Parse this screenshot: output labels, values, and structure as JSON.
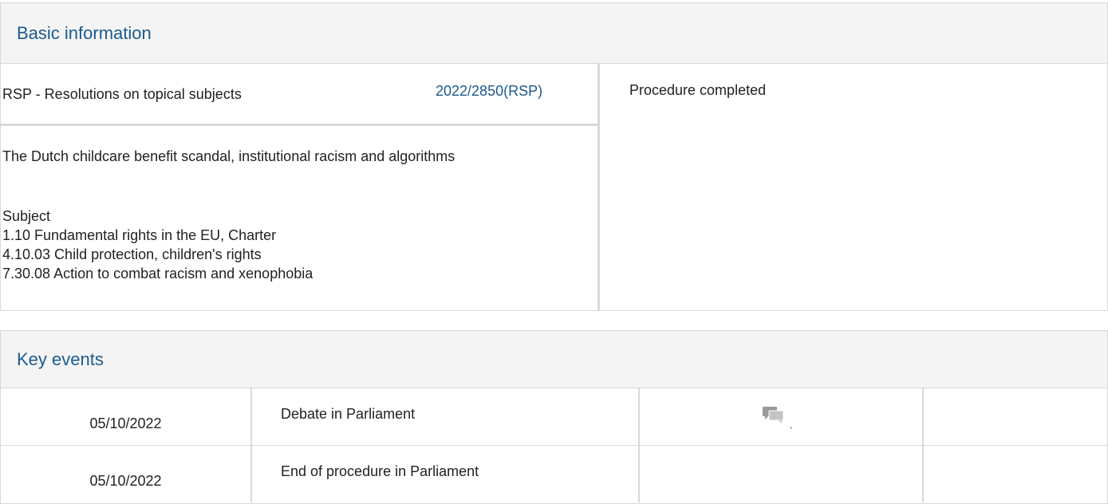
{
  "basic": {
    "heading": "Basic information",
    "procedure_type": "RSP - Resolutions on topical subjects",
    "procedure_ref": "2022/2850(RSP)",
    "status": "Procedure completed",
    "title": "The Dutch childcare benefit scandal, institutional racism and algorithms",
    "subject_label": "Subject",
    "subjects": [
      "1.10 Fundamental rights in the EU, Charter",
      "4.10.03 Child protection, children's rights",
      "7.30.08 Action to combat racism and xenophobia"
    ]
  },
  "events": {
    "heading": "Key events",
    "rows": [
      {
        "date": "05/10/2022",
        "event": "Debate in Parliament",
        "icon": "debate-icon"
      },
      {
        "date": "05/10/2022",
        "event": "End of procedure in Parliament",
        "icon": ""
      }
    ]
  },
  "colors": {
    "link": "#1b5a8e",
    "border": "#d9d9d9",
    "header_bg": "#f4f4f4"
  }
}
